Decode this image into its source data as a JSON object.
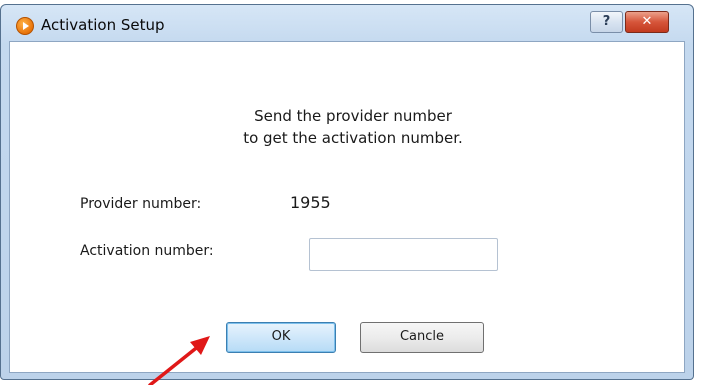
{
  "window": {
    "title": "Activation Setup",
    "icon": "media-player-icon",
    "help_label": "?",
    "close_label": "✕"
  },
  "dialog": {
    "message_line1": "Send the provider number",
    "message_line2": "to get the activation number.",
    "provider_label": "Provider number:",
    "provider_value": "1955",
    "activation_label": "Activation number:",
    "activation_value": "",
    "ok_label": "OK",
    "cancel_label": "Cancle"
  },
  "colors": {
    "annotation_arrow": "#e01818",
    "close_button": "#c94a2e",
    "frame": "#c4d9ef"
  }
}
